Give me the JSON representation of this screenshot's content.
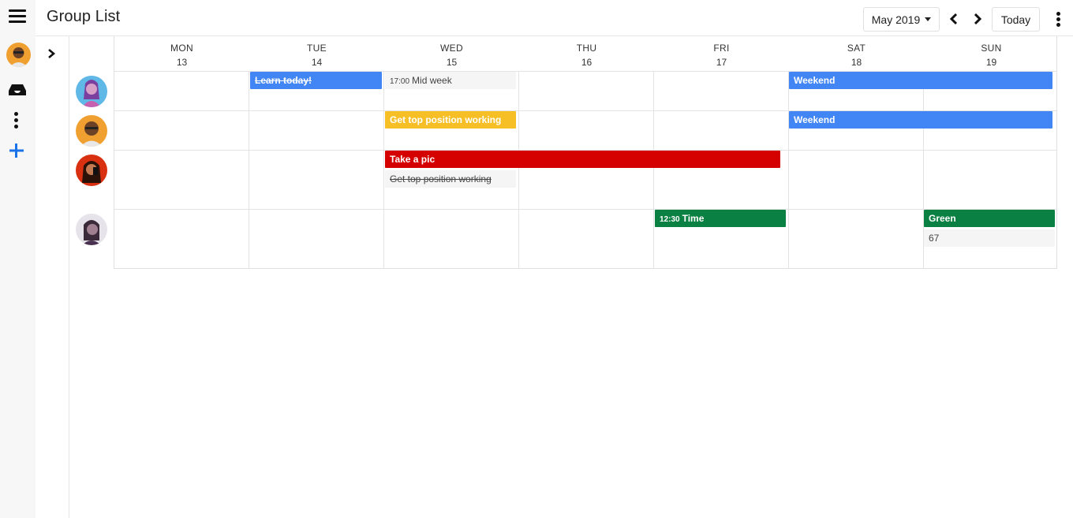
{
  "header": {
    "title": "Group List",
    "month_label": "May 2019",
    "today_label": "Today"
  },
  "rail": {
    "icons": [
      "menu-icon",
      "avatar",
      "inbox-icon",
      "more-vertical-icon",
      "plus-icon"
    ]
  },
  "days": [
    {
      "name": "MON",
      "date": "13"
    },
    {
      "name": "TUE",
      "date": "14"
    },
    {
      "name": "WED",
      "date": "15"
    },
    {
      "name": "THU",
      "date": "16"
    },
    {
      "name": "FRI",
      "date": "17"
    },
    {
      "name": "SAT",
      "date": "18"
    },
    {
      "name": "SUN",
      "date": "19"
    }
  ],
  "events": {
    "learn_today": {
      "label": "Learn today!"
    },
    "mid_week": {
      "time": "17:00",
      "label": "Mid week"
    },
    "weekend_1": {
      "label": "Weekend"
    },
    "get_top_1": {
      "label": "Get top position working"
    },
    "weekend_2": {
      "label": "Weekend"
    },
    "take_a_pic": {
      "label": "Take a pic"
    },
    "get_top_2": {
      "label": "Get top position working"
    },
    "time": {
      "time": "12:30",
      "label": "Time"
    },
    "green": {
      "label": "Green"
    },
    "sixty_seven": {
      "label": "67"
    }
  },
  "colors": {
    "blue": "#4285f4",
    "yellow": "#f6bf26",
    "red": "#d50000",
    "green": "#0b8043",
    "accent_plus": "#1a73e8"
  }
}
